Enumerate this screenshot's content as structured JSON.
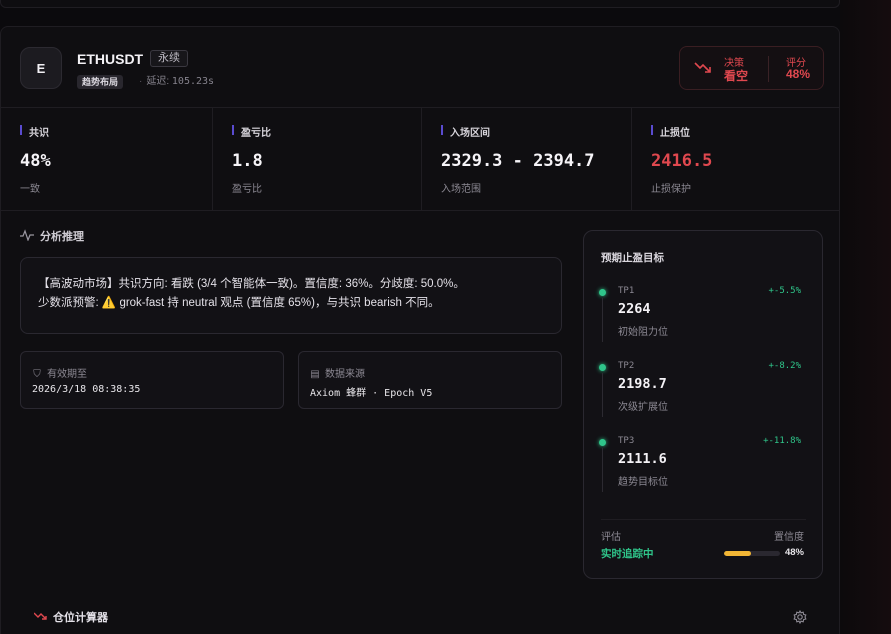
{
  "header": {
    "symbol_initial": "E",
    "symbol": "ETHUSDT",
    "contract_type": "永续",
    "mode_badge": "趋势布局",
    "latency_label": "延迟:",
    "latency_value": "105.23s"
  },
  "decision": {
    "label": "决策",
    "value": "看空",
    "score_label": "评分",
    "score_value": "48%",
    "color": "#e0484f"
  },
  "metrics": [
    {
      "label": "共识",
      "value": "48%",
      "sub": "一致"
    },
    {
      "label": "盈亏比",
      "value": "1.8",
      "sub": "盈亏比"
    },
    {
      "label": "入场区间",
      "value": "2329.3 - 2394.7",
      "sub": "入场范围"
    },
    {
      "label": "止损位",
      "value": "2416.5",
      "sub": "止损保护"
    }
  ],
  "analysis": {
    "title": "分析推理",
    "line1": "【高波动市场】共识方向: 看跌 (3/4 个智能体一致)。置信度: 36%。分歧度: 50.0%。",
    "line2_prefix": "少数派预警:",
    "warn_icon": "⚠️",
    "line2_text": "grok-fast 持 neutral 观点 (置信度 65%)，与共识 bearish 不同。"
  },
  "validity": {
    "label": "有效期至",
    "value": "2026/3/18 08:38:35"
  },
  "source": {
    "label": "数据来源",
    "value": "Axiom 蜂群 · Epoch V5"
  },
  "targets": {
    "title": "预期止盈目标",
    "items": [
      {
        "name": "TP1",
        "pct": "+-5.5%",
        "price": "2264",
        "desc": "初始阻力位"
      },
      {
        "name": "TP2",
        "pct": "+-8.2%",
        "price": "2198.7",
        "desc": "次级扩展位"
      },
      {
        "name": "TP3",
        "pct": "+-11.8%",
        "price": "2111.6",
        "desc": "趋势目标位"
      }
    ],
    "eval_label": "评估",
    "eval_value": "实时追踪中",
    "conf_label": "置信度",
    "conf_value": "48%",
    "conf_fraction": 0.48
  },
  "footer": {
    "calculator_label": "仓位计算器"
  },
  "colors": {
    "accent_purple": "#5a4bd0",
    "green": "#2fc58a",
    "red": "#e0484f",
    "yellow": "#f2b635"
  }
}
